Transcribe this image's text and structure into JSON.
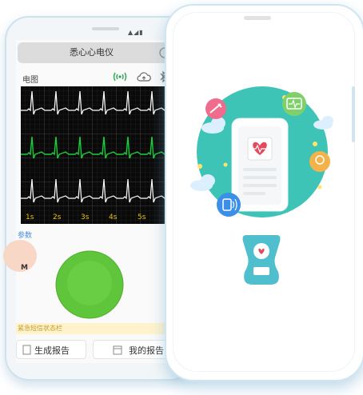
{
  "status_bar": {
    "icons": "▲◢▮"
  },
  "header": {
    "title": "悉心心电仪"
  },
  "toolbar": {
    "label": "电图"
  },
  "ecg": {
    "time_labels": [
      "1s",
      "2s",
      "3s",
      "4s",
      "5s"
    ],
    "colors": {
      "top": "#ffffff",
      "middle": "#1ccc3c",
      "bottom": "#ffffff"
    }
  },
  "section": {
    "label": "参数"
  },
  "side_fragment": {
    "letter": "M"
  },
  "alert": {
    "text": "紧急短信状态栏"
  },
  "actions": {
    "generate_report": "生成报告",
    "my_reports": "我的报告"
  },
  "colors": {
    "accent_green": "#5fc53a",
    "teal": "#3ec4b6",
    "device_blue": "#4fbfcd"
  }
}
